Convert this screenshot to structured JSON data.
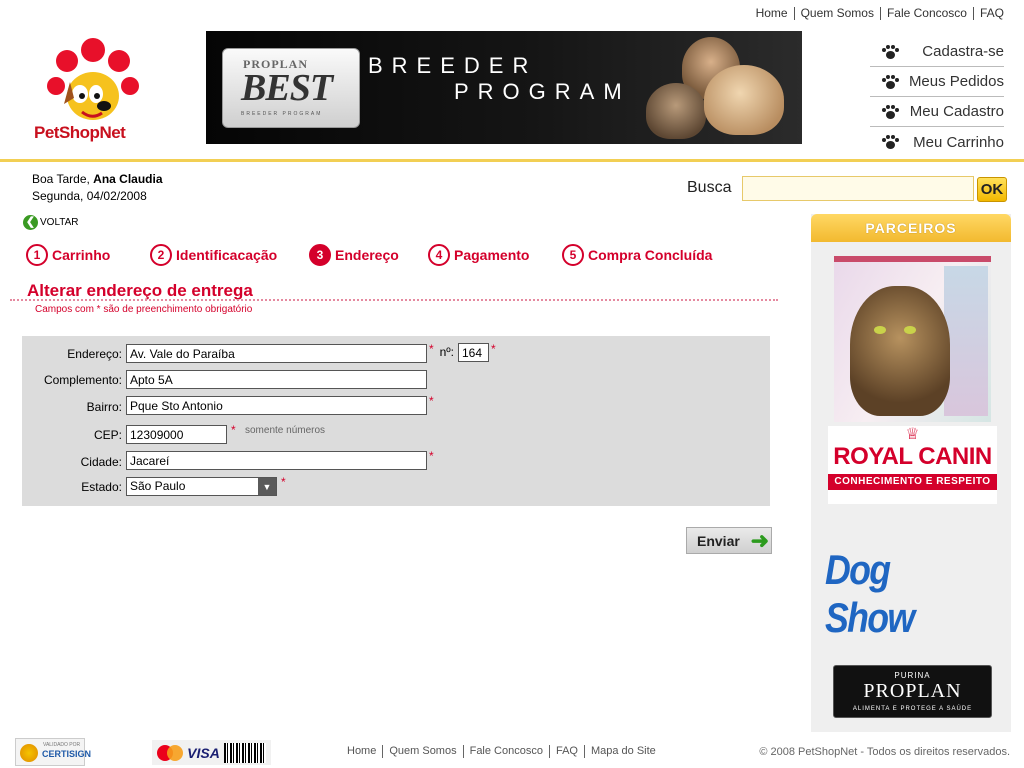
{
  "top_nav": {
    "items": [
      "Home",
      "Quem Somos",
      "Fale Concosco",
      "FAQ"
    ]
  },
  "logo": {
    "text": "PetShopNet"
  },
  "banner": {
    "brand_top": "PROPLAN",
    "brand_main": "BEST",
    "brand_small": "BREEDER PROGRAM",
    "line1": "BREEDER",
    "line2": "PROGRAM"
  },
  "account_menu": {
    "items": [
      "Cadastra-se",
      "Meus Pedidos",
      "Meu Cadastro",
      "Meu Carrinho"
    ]
  },
  "greeting": {
    "salutation": "Boa Tarde,",
    "user_name": "Ana Claudia",
    "date": "Segunda, 04/02/2008"
  },
  "search": {
    "label": "Busca",
    "value": "",
    "button": "OK"
  },
  "back": {
    "label": "VOLTAR"
  },
  "steps": [
    {
      "num": "1",
      "label": "Carrinho"
    },
    {
      "num": "2",
      "label": "Identificacação"
    },
    {
      "num": "3",
      "label": "Endereço"
    },
    {
      "num": "4",
      "label": "Pagamento"
    },
    {
      "num": "5",
      "label": "Compra Concluída"
    }
  ],
  "steps_active_index": 2,
  "page": {
    "title": "Alterar endereço de entrega",
    "required_note": "Campos com * são de preenchimento obrigatório"
  },
  "form": {
    "required_mark": "*",
    "endereco": {
      "label": "Endereço:",
      "value": "Av. Vale do Paraíba"
    },
    "numero": {
      "label": "nº:",
      "value": "164"
    },
    "complemento": {
      "label": "Complemento:",
      "value": "Apto 5A"
    },
    "bairro": {
      "label": "Bairro:",
      "value": "Pque Sto Antonio"
    },
    "cep": {
      "label": "CEP:",
      "value": "12309000",
      "hint": "somente números"
    },
    "cidade": {
      "label": "Cidade:",
      "value": "Jacareí"
    },
    "estado": {
      "label": "Estado:",
      "value": "São Paulo"
    },
    "submit": "Enviar"
  },
  "partners": {
    "title": "PARCEIROS",
    "royal_canin": {
      "name": "ROYAL CANIN",
      "tagline": "CONHECIMENTO E RESPEITO"
    },
    "dog_show": "Dog Show",
    "proplan": {
      "top": "PURINA",
      "name": "PROPLAN",
      "tagline": "ALIMENTA E PROTEGE A SAÚDE"
    }
  },
  "footer": {
    "certisign": {
      "small": "VALIDADO POR",
      "name": "CERTISIGN"
    },
    "payments": {
      "visa": "VISA"
    },
    "links": [
      "Home",
      "Quem Somos",
      "Fale Concosco",
      "FAQ",
      "Mapa do Site"
    ],
    "copyright": "© 2008 PetShopNet - Todos os direitos reservados."
  },
  "colors": {
    "accent_red": "#d4002b",
    "separator_yellow": "#f2cf54",
    "form_bg": "#dcdcdc"
  }
}
